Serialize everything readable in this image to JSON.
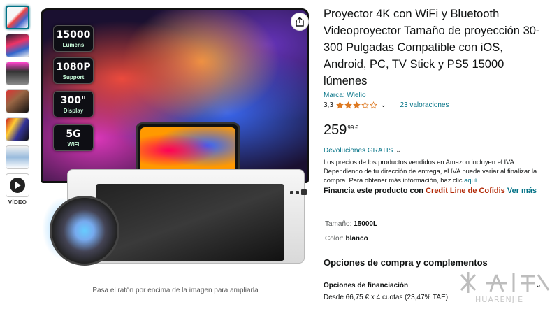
{
  "thumbnails": {
    "items": [
      "thumb-1",
      "thumb-2",
      "thumb-3",
      "thumb-4",
      "thumb-5",
      "thumb-6"
    ],
    "video_label": "VÍDEO"
  },
  "main_image": {
    "badges": [
      {
        "big": "15000",
        "small": "Lumens"
      },
      {
        "big": "1080P",
        "small": "Support"
      },
      {
        "big": "300\"",
        "small": "Display"
      },
      {
        "big": "5G",
        "small": "WiFi"
      }
    ],
    "hover_hint": "Pasa el ratón por encima de la imagen para ampliarla"
  },
  "product": {
    "title": "Proyector 4K con WiFi y Bluetooth Videoproyector Tamaño de proyección 30-300 Pulgadas Compatible con iOS, Android, PC, TV Stick y PS5 15000 lúmenes",
    "brand": "Marca: Wielio",
    "rating": "3,3",
    "rating_value": 3.3,
    "reviews": "23 valoraciones",
    "price_main": "259",
    "price_cents": "99",
    "currency": "€",
    "returns": "Devoluciones GRATIS",
    "vat_text": "Los precios de los productos vendidos en Amazon incluyen el IVA. Dependiendo de tu dirección de entrega, el IVA puede variar al finalizar la compra. Para obtener más información, haz clic",
    "vat_link": "aquí.",
    "financing_prefix": "Financia este producto con",
    "financing_brand": "Credit Line de Cofidis",
    "financing_link": "Ver más",
    "size_label": "Tamaño:",
    "size_value": "15000L",
    "color_label": "Color:",
    "color_value": "blanco"
  },
  "options": {
    "title": "Opciones de compra y complementos",
    "financing_label": "Opciones de financiación",
    "financing_detail": "Desde 66,75 € x 4 cuotas (23,47% TAE)"
  },
  "watermark": {
    "text": "HUARENJIE"
  },
  "colors": {
    "link": "#007185",
    "price_red": "#b12704",
    "star": "#de7921"
  }
}
